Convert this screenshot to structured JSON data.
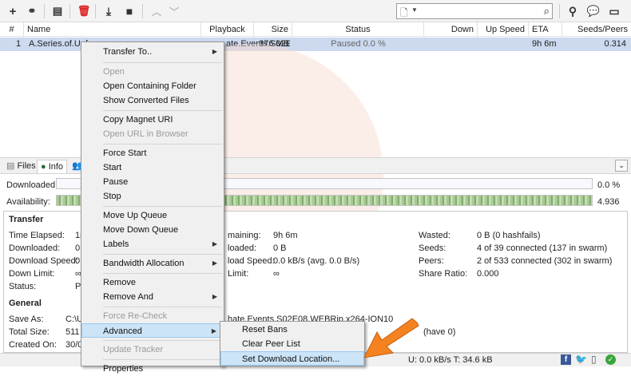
{
  "toolbar": {
    "icons": [
      "add-icon",
      "add-url-icon",
      "create-torrent-icon",
      "remove-icon",
      "download-icon",
      "stop-icon",
      "move-up-icon",
      "move-down-icon"
    ],
    "right_icons": [
      "location-pin-icon",
      "chat-icon",
      "monitor-icon",
      "gear-icon"
    ],
    "search_placeholder": ""
  },
  "list": {
    "columns": [
      "#",
      "Name",
      "Playback",
      "Size",
      "Status",
      "Down Speed",
      "Up Speed",
      "ETA",
      "Seeds/Peers"
    ],
    "rows": [
      {
        "num": "1",
        "name": "A.Series.of.Unf",
        "name_tail": "ate.Events.S02E08.WEBR",
        "size": "376 MB",
        "status": "Paused 0.0 %",
        "eta": "9h 6m",
        "seeds": "0.314"
      }
    ]
  },
  "tabs": [
    "Files",
    "Info"
  ],
  "progress": {
    "downloaded_label": "Downloaded:",
    "downloaded_val": "0.0 %",
    "downloaded_fraction": 0.0,
    "availability_label": "Availability:",
    "availability_val": "4.936"
  },
  "transfer": {
    "title": "Transfer",
    "left_labels": [
      "Time Elapsed:",
      "Downloaded:",
      "Download Speed:",
      "Down Limit:",
      "Status:"
    ],
    "left_vals": [
      "1s",
      "0",
      "0.",
      "∞",
      "P"
    ],
    "mid_labels": [
      "maining:",
      "loaded:",
      "load Speed:",
      "Limit:"
    ],
    "mid_vals": [
      "9h 6m",
      "0 B",
      "0.0 kB/s (avg. 0.0 B/s)",
      "∞"
    ],
    "right_labels": [
      "Wasted:",
      "Seeds:",
      "Peers:",
      "Share Ratio:"
    ],
    "right_vals": [
      "0 B (0 hashfails)",
      "4 of 39 connected (137 in swarm)",
      "2 of 533 connected (302 in swarm)",
      "0.000"
    ]
  },
  "general": {
    "title": "General",
    "labels": [
      "Save As:",
      "Total Size:",
      "Created On:"
    ],
    "vals": [
      "C:\\U",
      "511",
      "30/0"
    ],
    "save_as_tail": "hate.Events.S02E08.WEBRip.x264-ION10",
    "total_size_tail": "(have 0)"
  },
  "statusbar": {
    "text": "U: 0.0 kB/s T: 34.6 kB"
  },
  "context_menu": {
    "items": [
      {
        "label": "Transfer To..",
        "submenu": true,
        "disabled": false
      },
      {
        "label": "Open",
        "disabled": true
      },
      {
        "label": "Open Containing Folder",
        "disabled": false
      },
      {
        "label": "Show Converted Files",
        "disabled": false
      },
      {
        "label": "Copy Magnet URI",
        "disabled": false
      },
      {
        "label": "Open URL in Browser",
        "disabled": true
      },
      {
        "label": "Force Start",
        "disabled": false
      },
      {
        "label": "Start",
        "disabled": false
      },
      {
        "label": "Pause",
        "disabled": false
      },
      {
        "label": "Stop",
        "disabled": false
      },
      {
        "label": "Move Up Queue",
        "disabled": false
      },
      {
        "label": "Move Down Queue",
        "disabled": false
      },
      {
        "label": "Labels",
        "submenu": true,
        "disabled": false
      },
      {
        "label": "Bandwidth Allocation",
        "submenu": true,
        "disabled": false
      },
      {
        "label": "Remove",
        "disabled": false
      },
      {
        "label": "Remove And",
        "submenu": true,
        "disabled": false
      },
      {
        "label": "Force Re-Check",
        "disabled": true
      },
      {
        "label": "Advanced",
        "submenu": true,
        "disabled": false,
        "highlighted": true
      },
      {
        "label": "Update Tracker",
        "disabled": true
      },
      {
        "label": "Properties",
        "disabled": false
      }
    ]
  },
  "submenu": {
    "items": [
      {
        "label": "Reset Bans"
      },
      {
        "label": "Clear Peer List"
      },
      {
        "label": "Set Download Location...",
        "highlighted": true
      }
    ]
  },
  "colors": {
    "selection": "#ccd9ef",
    "menu_highlight": "#cce4f7",
    "arrow": "#f58220"
  }
}
